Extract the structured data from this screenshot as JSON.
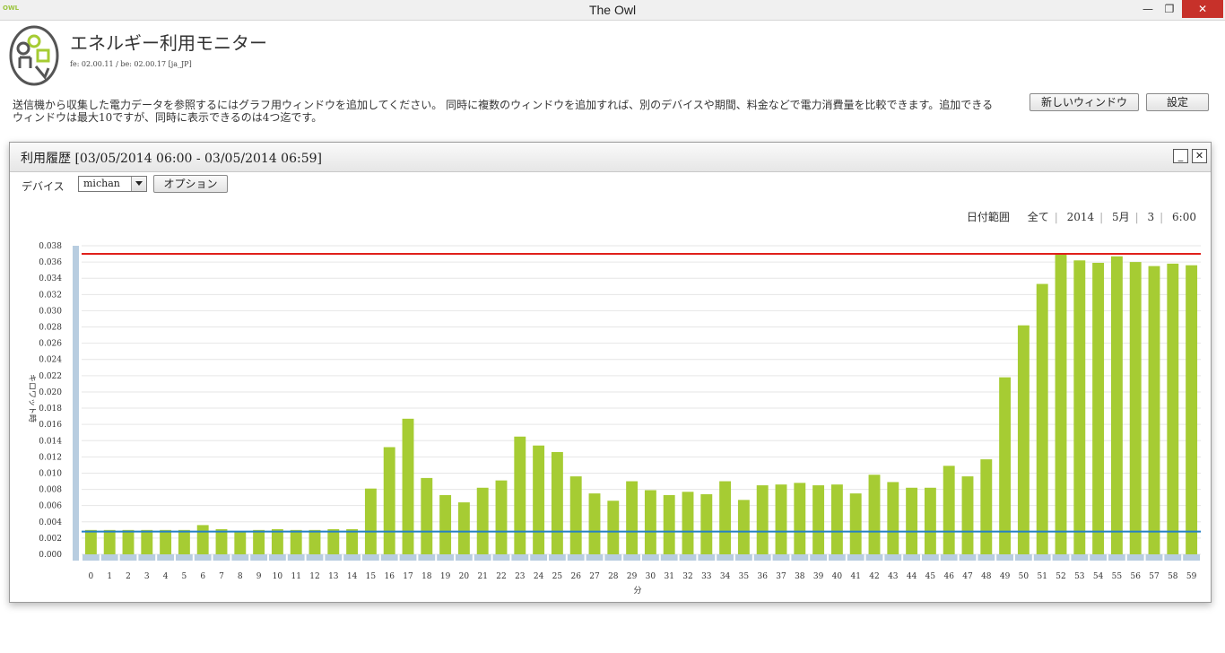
{
  "window": {
    "title": "The Owl",
    "app_icon_text": "OWL",
    "minimize": "—",
    "maximize": "❐",
    "close": "✕"
  },
  "header": {
    "app_title": "エネルギー利用モニター",
    "version": "fe: 02.00.11 / be: 02.00.17 [ja_JP]",
    "description": "送信機から収集した電力データを参照するにはグラフ用ウィンドウを追加してください。 同時に複数のウィンドウを追加すれば、別のデバイスや期間、料金などで電力消費量を比較できます。追加できるウィンドウは最大10ですが、同時に表示できるのは4つ迄です。",
    "new_window_button": "新しいウィンドウ",
    "settings_button": "設定"
  },
  "panel": {
    "title": "利用履歴 [03/05/2014 06:00 - 03/05/2014 06:59]",
    "minimize_button": "_",
    "close_button": "✕",
    "device_label": "デバイス",
    "device_selected": "michan",
    "options_button": "オプション",
    "date_range": {
      "label": "日付範囲",
      "items": [
        "全て",
        "2014",
        "5月",
        "3",
        "6:00"
      ]
    }
  },
  "chart_data": {
    "type": "bar",
    "xlabel": "分",
    "ylabel": "キロワット時",
    "categories": [
      "0",
      "1",
      "2",
      "3",
      "4",
      "5",
      "6",
      "7",
      "8",
      "9",
      "10",
      "11",
      "12",
      "13",
      "14",
      "15",
      "16",
      "17",
      "18",
      "19",
      "20",
      "21",
      "22",
      "23",
      "24",
      "25",
      "26",
      "27",
      "28",
      "29",
      "30",
      "31",
      "32",
      "33",
      "34",
      "35",
      "36",
      "37",
      "38",
      "39",
      "40",
      "41",
      "42",
      "43",
      "44",
      "45",
      "46",
      "47",
      "48",
      "49",
      "50",
      "51",
      "52",
      "53",
      "54",
      "55",
      "56",
      "57",
      "58",
      "59"
    ],
    "values": [
      0.003,
      0.003,
      0.003,
      0.003,
      0.003,
      0.003,
      0.0036,
      0.0031,
      0.0028,
      0.003,
      0.0031,
      0.003,
      0.003,
      0.0031,
      0.0031,
      0.0081,
      0.0132,
      0.0167,
      0.0094,
      0.0073,
      0.0064,
      0.0082,
      0.0091,
      0.0145,
      0.0134,
      0.0126,
      0.0096,
      0.0075,
      0.0066,
      0.009,
      0.0079,
      0.0073,
      0.0077,
      0.0074,
      0.009,
      0.0067,
      0.0085,
      0.0086,
      0.0088,
      0.0085,
      0.0086,
      0.0075,
      0.0098,
      0.0089,
      0.0082,
      0.0082,
      0.0109,
      0.0096,
      0.0117,
      0.0218,
      0.0282,
      0.0333,
      0.037,
      0.0362,
      0.0359,
      0.0367,
      0.036,
      0.0355,
      0.0358,
      0.0356
    ],
    "ylim": [
      0,
      0.038
    ],
    "yticks": [
      "0.000",
      "0.002",
      "0.004",
      "0.006",
      "0.008",
      "0.010",
      "0.012",
      "0.014",
      "0.016",
      "0.018",
      "0.020",
      "0.022",
      "0.024",
      "0.026",
      "0.028",
      "0.030",
      "0.032",
      "0.034",
      "0.036",
      "0.038"
    ],
    "max_line": 0.037,
    "min_line": 0.0028,
    "grid": true,
    "colors": {
      "bar": "#a6cc33",
      "max_line": "#e0201b",
      "min_line": "#2580c6",
      "axis_bar": "#b8cde0"
    }
  }
}
